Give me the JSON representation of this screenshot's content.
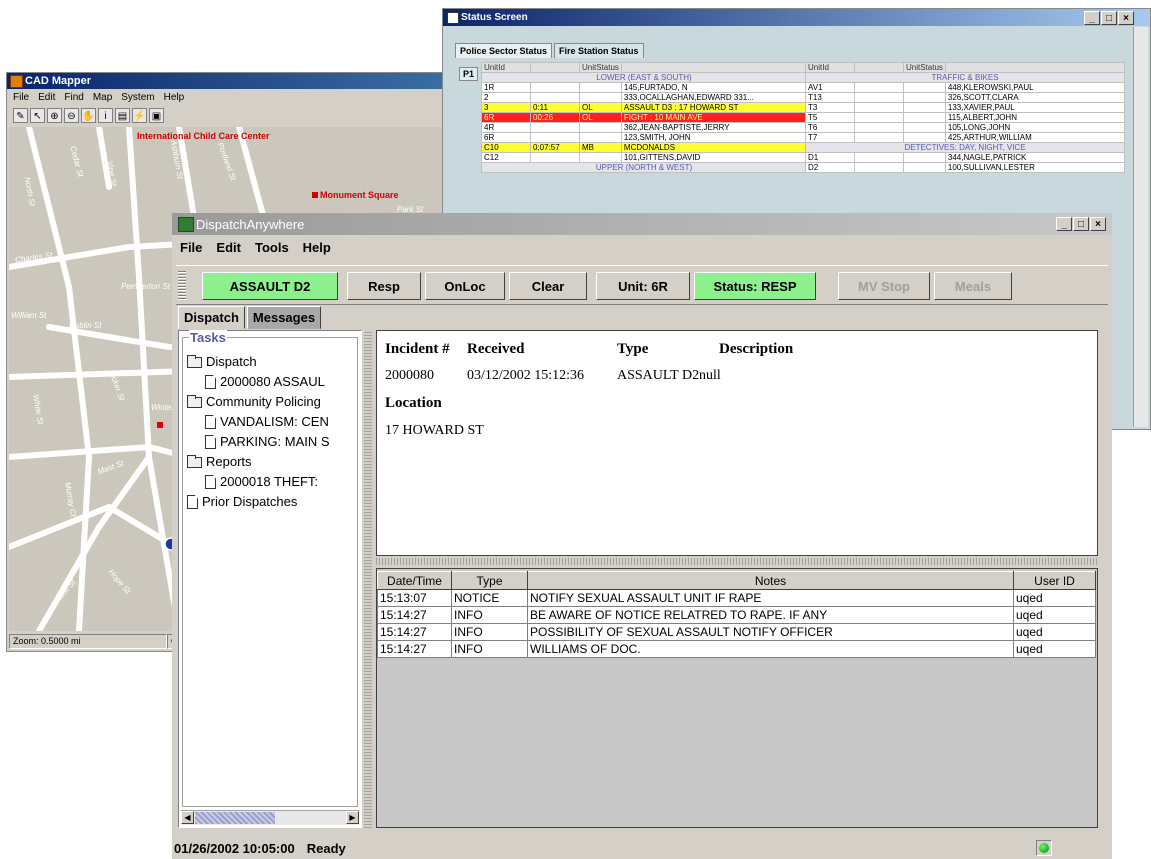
{
  "cad_mapper": {
    "title": "CAD Mapper",
    "menu": [
      "File",
      "Edit",
      "Find",
      "Map",
      "System",
      "Help"
    ],
    "map_labels": {
      "international_child_care": "International Child Care Center",
      "monument_square": "Monument Square",
      "charles_st": "Charles St",
      "pemberton_st": "Pemberton St",
      "william_st": "William St",
      "dublin_st": "Dublin St",
      "winter_st": "Winter St",
      "mast_st": "Mast St",
      "north_st": "North St",
      "cedar_st": "Cedar St",
      "ashburn_st": "Ashburn St",
      "portland_st": "Portland St",
      "vine_st": "Vine St",
      "ficker_st": "Ficker St",
      "white_st": "White St",
      "murray_ct": "Murray Ct",
      "west_st": "West St",
      "hope_st": "Hope St",
      "park_st": "Park St"
    },
    "zoom_label": "Zoom: 0.5000 mi",
    "status_right": "Cu"
  },
  "status_screen": {
    "title": "Status Screen",
    "tabs": [
      "Police Sector Status",
      "Fire Station Status"
    ],
    "page_label": "P1",
    "left_headers": [
      "UnitId",
      "",
      "UnitStatus",
      ""
    ],
    "right_headers": [
      "UnitId",
      "",
      "UnitStatus",
      ""
    ],
    "left_rows": [
      {
        "kind": "sec",
        "text": "LOWER (EAST & SOUTH)"
      },
      {
        "kind": "",
        "c": [
          "1R",
          "",
          "",
          "145,FURTADO, N"
        ]
      },
      {
        "kind": "",
        "c": [
          "2",
          "",
          "",
          "333,OCALLAGHAN,EDWARD 331..."
        ]
      },
      {
        "kind": "yellow",
        "c": [
          "3",
          "0:11",
          "OL",
          "ASSAULT D3 : 17 HOWARD ST"
        ]
      },
      {
        "kind": "red",
        "c": [
          "6R",
          "00:26",
          "OL",
          "FIGHT : 10 MAIN AVE"
        ]
      },
      {
        "kind": "",
        "c": [
          "4R",
          "",
          "",
          "362,JEAN-BAPTISTE,JERRY"
        ]
      },
      {
        "kind": "",
        "c": [
          "6R",
          "",
          "",
          "123,SMITH, JOHN"
        ]
      },
      {
        "kind": "yellow",
        "c": [
          "C10",
          "0:07:57",
          "MB",
          "MCDONALDS"
        ]
      },
      {
        "kind": "",
        "c": [
          "C12",
          "",
          "",
          "101,GITTENS,DAVID"
        ]
      },
      {
        "kind": "sec",
        "text": "UPPER (NORTH & WEST)"
      }
    ],
    "right_rows": [
      {
        "kind": "sec",
        "text": "TRAFFIC & BIKES"
      },
      {
        "kind": "",
        "c": [
          "AV1",
          "",
          "",
          "448,KLEROWSKI,PAUL"
        ]
      },
      {
        "kind": "",
        "c": [
          "T13",
          "",
          "",
          "326,SCOTT,CLARA"
        ]
      },
      {
        "kind": "",
        "c": [
          "T3",
          "",
          "",
          "133,XAVIER,PAUL"
        ]
      },
      {
        "kind": "",
        "c": [
          "T5",
          "",
          "",
          "115,ALBERT,JOHN"
        ]
      },
      {
        "kind": "",
        "c": [
          "T6",
          "",
          "",
          "105,LONG,JOHN"
        ]
      },
      {
        "kind": "",
        "c": [
          "T7",
          "",
          "",
          "425,ARTHUR,WILLIAM"
        ]
      },
      {
        "kind": "sec",
        "text": "DETECTIVES: DAY, NIGHT, VICE"
      },
      {
        "kind": "",
        "c": [
          "D1",
          "",
          "",
          "344,NAGLE,PATRICK"
        ]
      },
      {
        "kind": "",
        "c": [
          "D2",
          "",
          "",
          "100,SULLIVAN,LESTER"
        ]
      }
    ]
  },
  "dispatch": {
    "title": "DispatchAnywhere",
    "menu": [
      "File",
      "Edit",
      "Tools",
      "Help"
    ],
    "toolbar": {
      "incident": "ASSAULT D2",
      "resp": "Resp",
      "onloc": "OnLoc",
      "clear": "Clear",
      "unit": "Unit: 6R",
      "status": "Status: RESP",
      "mvstop": "MV Stop",
      "meals": "Meals"
    },
    "tabs": [
      "Dispatch",
      "Messages"
    ],
    "tasks": {
      "legend": "Tasks",
      "tree": [
        {
          "level": 1,
          "icon": "folder",
          "label": "Dispatch"
        },
        {
          "level": 2,
          "icon": "doc",
          "label": "2000080 ASSAUL"
        },
        {
          "level": 1,
          "icon": "folder",
          "label": "Community Policing"
        },
        {
          "level": 2,
          "icon": "doc",
          "label": "VANDALISM: CEN"
        },
        {
          "level": 2,
          "icon": "doc",
          "label": "PARKING: MAIN S"
        },
        {
          "level": 1,
          "icon": "folder",
          "label": "Reports"
        },
        {
          "level": 2,
          "icon": "doc",
          "label": "2000018 THEFT:"
        },
        {
          "level": 1,
          "icon": "doc",
          "label": "Prior Dispatches"
        }
      ]
    },
    "detail": {
      "incident_header": "Incident #",
      "received_header": "Received",
      "type_header": "Type",
      "description_header": "Description",
      "incident_no": "2000080",
      "received": "03/12/2002 15:12:36",
      "type": "ASSAULT D2",
      "description": "null",
      "location_header": "Location",
      "location": "17 HOWARD ST"
    },
    "notes": {
      "headers": [
        "Date/Time",
        "Type",
        "Notes",
        "User ID"
      ],
      "rows": [
        [
          "15:13:07",
          "NOTICE",
          "NOTIFY SEXUAL ASSAULT UNIT IF RAPE",
          "uqed"
        ],
        [
          "15:14:27",
          "INFO",
          "BE AWARE OF NOTICE RELATRED TO RAPE. IF ANY",
          "uqed"
        ],
        [
          "15:14:27",
          "INFO",
          "POSSIBILITY OF SEXUAL ASSAULT NOTIFY OFFICER",
          "uqed"
        ],
        [
          "15:14:27",
          "INFO",
          "WILLIAMS OF DOC.",
          "uqed"
        ]
      ]
    },
    "statusbar": {
      "datetime": "01/26/2002 10:05:00",
      "state": "Ready"
    },
    "colors": {
      "green_button": "#8cf08c",
      "led": "#00aa00"
    }
  }
}
